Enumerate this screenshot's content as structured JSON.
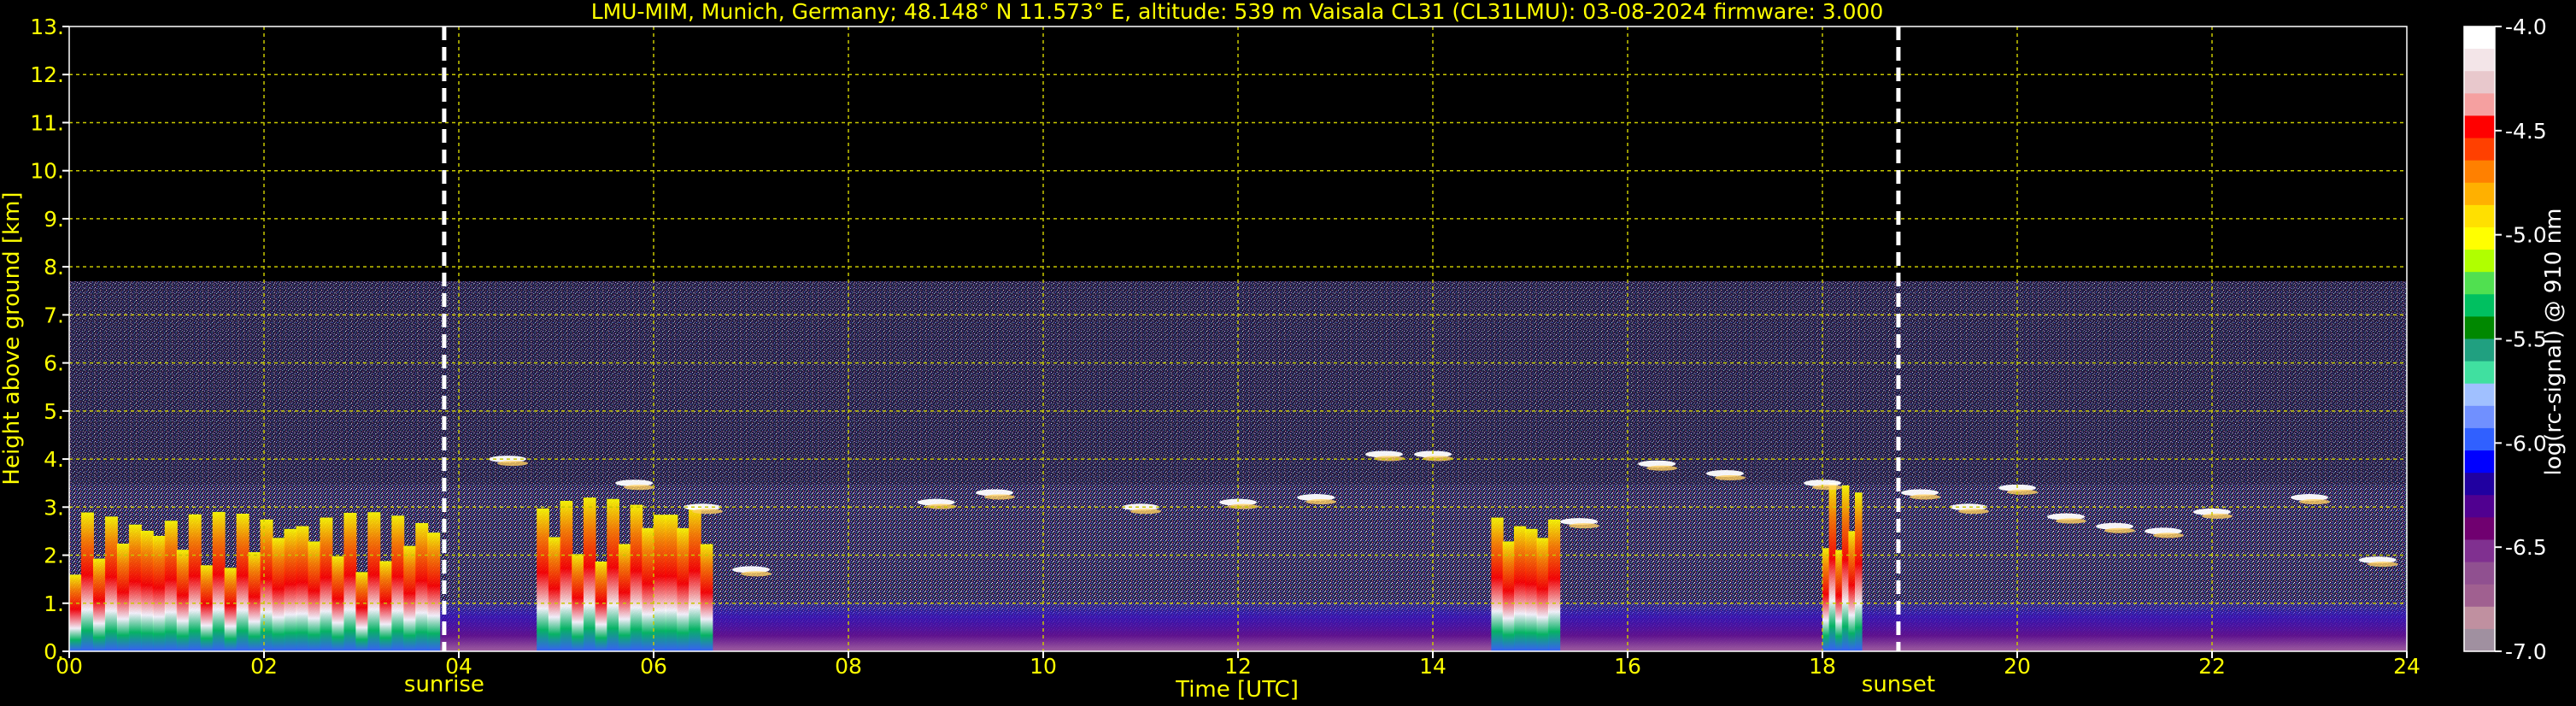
{
  "chart_data": {
    "type": "heatmap",
    "title": "LMU-MIM, Munich, Germany; 48.148° N 11.573° E, altitude: 539 m    Vaisala CL31 (CL31LMU): 03-08-2024    firmware: 3.000",
    "xlabel": "Time [UTC]",
    "ylabel": "Height above ground [km]",
    "xlim": [
      0,
      24
    ],
    "ylim": [
      0,
      13
    ],
    "x_ticks": [
      "00",
      "02",
      "04",
      "06",
      "08",
      "10",
      "12",
      "14",
      "16",
      "18",
      "20",
      "22",
      "24"
    ],
    "y_ticks": [
      "0.",
      "1.",
      "2.",
      "3.",
      "4.",
      "5.",
      "6.",
      "7.",
      "8.",
      "9.",
      "10.",
      "11.",
      "12.",
      "13."
    ],
    "grid": true,
    "data_top_km": 7.7,
    "events": [
      {
        "label": "sunrise",
        "time_utc": 3.85
      },
      {
        "label": "sunset",
        "time_utc": 18.78
      }
    ],
    "colorbar": {
      "label": "log(rc-signal) @ 910 nm",
      "range": [
        -7.0,
        -4.0
      ],
      "ticks": [
        "-4.0",
        "-4.5",
        "-5.0",
        "-5.5",
        "-6.0",
        "-6.5",
        "-7.0"
      ],
      "colors": [
        "#ffffff",
        "#f3e5e8",
        "#e8c8cc",
        "#f5a0a0",
        "#ff0000",
        "#ff4000",
        "#ff8000",
        "#ffb000",
        "#ffe000",
        "#ffff00",
        "#b0ff00",
        "#50e050",
        "#00c060",
        "#008800",
        "#20a080",
        "#40e0a0",
        "#a0c0ff",
        "#7090ff",
        "#3060ff",
        "#0000ff",
        "#2000a0",
        "#500090",
        "#700070",
        "#803090",
        "#905090",
        "#a06090",
        "#c090a0",
        "#a090a0"
      ]
    },
    "clouds": [
      {
        "t": 4.5,
        "h": 4.0
      },
      {
        "t": 5.8,
        "h": 3.5
      },
      {
        "t": 6.5,
        "h": 3.0
      },
      {
        "t": 7.0,
        "h": 1.7
      },
      {
        "t": 8.9,
        "h": 3.1
      },
      {
        "t": 9.5,
        "h": 3.3
      },
      {
        "t": 11.0,
        "h": 3.0
      },
      {
        "t": 12.0,
        "h": 3.1
      },
      {
        "t": 12.8,
        "h": 3.2
      },
      {
        "t": 13.5,
        "h": 4.1
      },
      {
        "t": 14.0,
        "h": 4.1
      },
      {
        "t": 15.5,
        "h": 2.7
      },
      {
        "t": 16.3,
        "h": 3.9
      },
      {
        "t": 17.0,
        "h": 3.7
      },
      {
        "t": 18.0,
        "h": 3.5
      },
      {
        "t": 19.0,
        "h": 3.3
      },
      {
        "t": 19.5,
        "h": 3.0
      },
      {
        "t": 20.0,
        "h": 3.4
      },
      {
        "t": 20.5,
        "h": 2.8
      },
      {
        "t": 21.0,
        "h": 2.6
      },
      {
        "t": 21.5,
        "h": 2.5
      },
      {
        "t": 22.0,
        "h": 2.9
      },
      {
        "t": 23.0,
        "h": 3.2
      },
      {
        "t": 23.7,
        "h": 1.9
      }
    ],
    "strong_signal_events": [
      {
        "t_start": 0.0,
        "t_end": 3.8,
        "h_top": 2.9
      },
      {
        "t_start": 4.8,
        "t_end": 6.6,
        "h_top": 3.2
      },
      {
        "t_start": 14.6,
        "t_end": 15.3,
        "h_top": 2.9
      },
      {
        "t_start": 18.0,
        "t_end": 18.4,
        "h_top": 3.5
      }
    ]
  }
}
